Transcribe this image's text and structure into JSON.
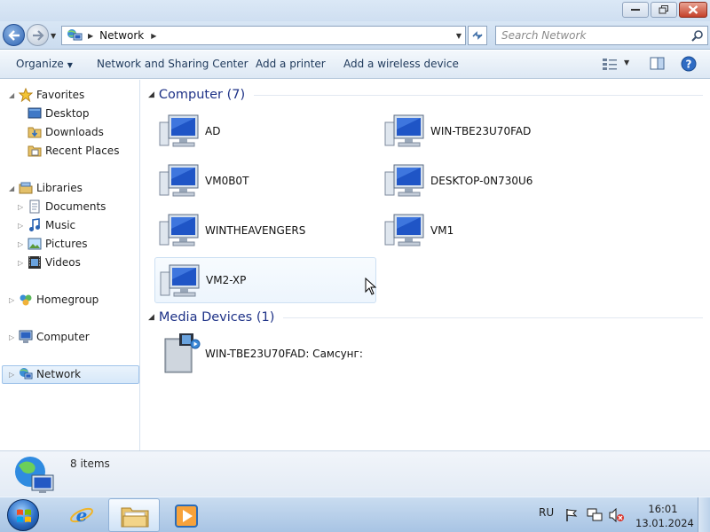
{
  "window": {
    "address": {
      "crumb": "Network"
    },
    "search": {
      "placeholder": "Search Network"
    }
  },
  "toolbar": {
    "organize": "Organize",
    "network_sharing": "Network and Sharing Center",
    "add_printer": "Add a printer",
    "add_wireless": "Add a wireless device"
  },
  "nav": {
    "favorites": "Favorites",
    "desktop": "Desktop",
    "downloads": "Downloads",
    "recent_places": "Recent Places",
    "libraries": "Libraries",
    "documents": "Documents",
    "music": "Music",
    "pictures": "Pictures",
    "videos": "Videos",
    "homegroup": "Homegroup",
    "computer": "Computer",
    "network": "Network"
  },
  "content": {
    "computer_group": "Computer (7)",
    "media_group": "Media Devices (1)",
    "computers": [
      "AD",
      "WIN-TBE23U70FAD",
      "VM0B0T",
      "DESKTOP-0N730U6",
      "WINTHEAVENGERS",
      "VM1",
      "VM2-XP"
    ],
    "media_device": "WIN-TBE23U70FAD: Самсунг:"
  },
  "details": {
    "count": "8 items"
  },
  "taskbar": {
    "language": "RU",
    "time": "16:01",
    "date": "13.01.2024"
  },
  "colors": {
    "group_title": "#1e3287",
    "selection": "#d7e8f9",
    "close_button": "#c4412a"
  }
}
